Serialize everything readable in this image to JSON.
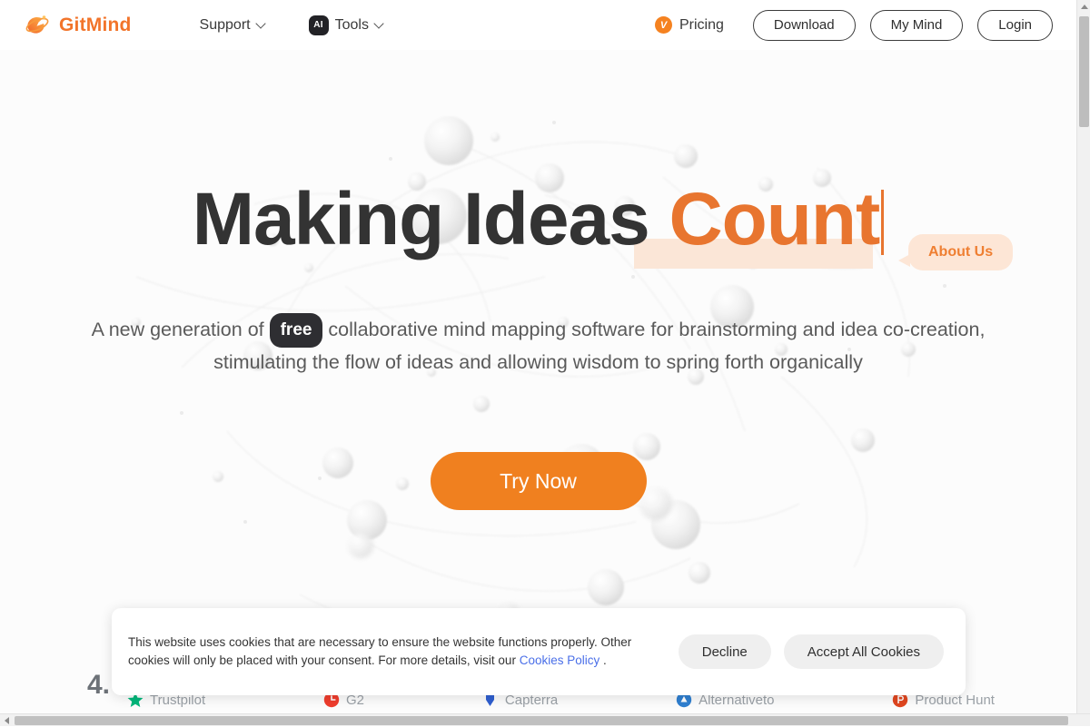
{
  "header": {
    "brand": {
      "name": "GitMind",
      "logo_icon": "gitmind-swirl-logo",
      "color": "#f2742a"
    },
    "nav": [
      {
        "label": "Support",
        "icon": "chevron-down-icon"
      },
      {
        "label": "Tools",
        "icon": "chevron-down-icon",
        "badge": "AI"
      }
    ],
    "pricing": {
      "label": "Pricing",
      "icon": "vip-crown-icon"
    },
    "buttons": [
      {
        "label": "Download"
      },
      {
        "label": "My Mind"
      },
      {
        "label": "Login"
      }
    ]
  },
  "hero": {
    "headline_plain": "Making Ideas ",
    "headline_accent": "Count",
    "accent_color": "#e8752f",
    "highlight_color": "#fbe6d7",
    "bubble": {
      "label": "About Us"
    },
    "subhead_part1": "A new generation of ",
    "subhead_pill": "free",
    "subhead_part2": " collaborative mind mapping software for brainstorming and idea co-creation, stimulating the flow of ideas and allowing wisdom to spring forth organically",
    "cta": {
      "label": "Try Now",
      "color": "#f0801f"
    }
  },
  "ratings": {
    "score": "4.",
    "logos": [
      {
        "name": "Trustpilot",
        "mark": "star-icon",
        "color": "#00b67a"
      },
      {
        "name": "G2",
        "mark": "circle-icon",
        "color": "#ef3d2d"
      },
      {
        "name": "Capterra",
        "mark": "flag-icon",
        "color": "#2f5fd0"
      },
      {
        "name": "Alternativeto",
        "mark": "circle-icon",
        "color": "#2f7fd0"
      },
      {
        "name": "Product Hunt",
        "mark": "circle-icon",
        "color": "#e0461f"
      }
    ]
  },
  "cookie_banner": {
    "text_before_link": "This website uses cookies that are necessary to ensure the website functions properly. Other cookies will only be placed with your consent. For more details, visit our ",
    "link_label": "Cookies Policy",
    "text_after_link": " .",
    "decline_label": "Decline",
    "accept_label": "Accept All Cookies"
  },
  "scrollbars": {
    "vertical_icon": "scroll-up-arrow-icon",
    "horizontal_icon": "scroll-left-arrow-icon"
  }
}
